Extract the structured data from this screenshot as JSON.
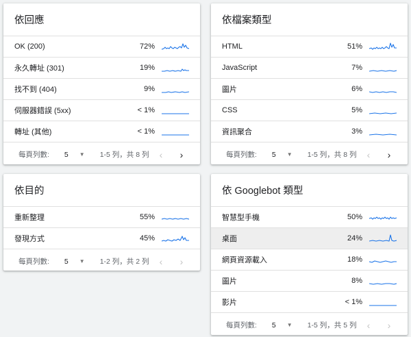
{
  "footer_labels": {
    "rows_per_page": "每頁列數:",
    "prev_icon": "‹",
    "next_icon": "›",
    "caret_icon": "▼"
  },
  "colors": {
    "sparkline": "#1a73e8",
    "highlight_row": "#eeeeee"
  },
  "cards": [
    {
      "title": "依回應",
      "rows": [
        {
          "label": "OK (200)",
          "pct": "72%"
        },
        {
          "label": "永久轉址 (301)",
          "pct": "19%"
        },
        {
          "label": "找不到 (404)",
          "pct": "9%"
        },
        {
          "label": "伺服器錯誤 (5xx)",
          "pct": "< 1%"
        },
        {
          "label": "轉址 (其他)",
          "pct": "< 1%"
        }
      ],
      "footer": {
        "rows_per_page": "5",
        "range": "1-5 列，共 8 列"
      }
    },
    {
      "title": "依檔案類型",
      "rows": [
        {
          "label": "HTML",
          "pct": "51%"
        },
        {
          "label": "JavaScript",
          "pct": "7%"
        },
        {
          "label": "圖片",
          "pct": "6%"
        },
        {
          "label": "CSS",
          "pct": "5%"
        },
        {
          "label": "資訊聚合",
          "pct": "3%"
        }
      ],
      "footer": {
        "rows_per_page": "5",
        "range": "1-5 列，共 8 列"
      }
    },
    {
      "title": "依目的",
      "rows": [
        {
          "label": "重新整理",
          "pct": "55%"
        },
        {
          "label": "發現方式",
          "pct": "45%"
        }
      ],
      "footer": {
        "rows_per_page": "5",
        "range": "1-2 列，共 2 列"
      }
    },
    {
      "title": "依 Googlebot 類型",
      "rows": [
        {
          "label": "智慧型手機",
          "pct": "50%"
        },
        {
          "label": "桌面",
          "pct": "24%"
        },
        {
          "label": "網頁資源載入",
          "pct": "18%"
        },
        {
          "label": "圖片",
          "pct": "8%"
        },
        {
          "label": "影片",
          "pct": "< 1%"
        }
      ],
      "footer": {
        "rows_per_page": "5",
        "range": "1-5 列，共 5 列"
      }
    }
  ]
}
